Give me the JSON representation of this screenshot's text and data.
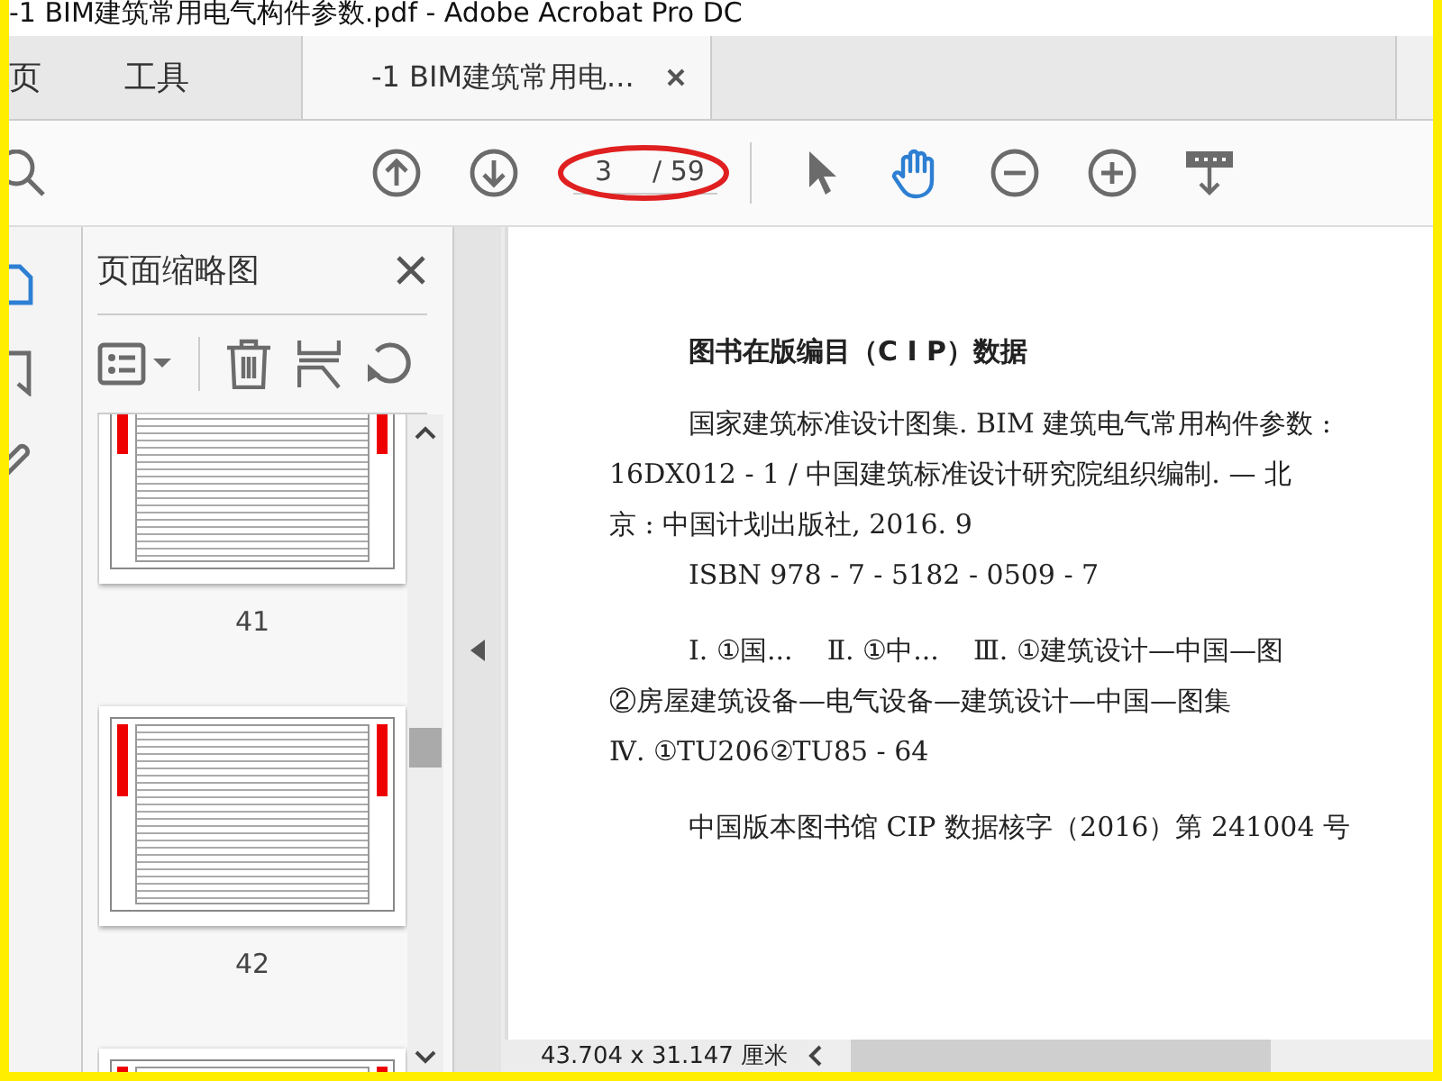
{
  "window": {
    "title": "-1 BIM建筑常用电气构件参数.pdf - Adobe Acrobat Pro DC"
  },
  "tabs": [
    {
      "label": "页",
      "selected": false,
      "closable": false
    },
    {
      "label": "工具",
      "selected": false,
      "closable": false
    },
    {
      "label": "-1 BIM建筑常用电...",
      "selected": true,
      "closable": true
    }
  ],
  "toolbar": {
    "page_number": "3",
    "page_total": "/ 59",
    "tools": [
      {
        "selected": false
      },
      {
        "selected": true
      },
      {
        "selected": false
      },
      {
        "selected": false
      },
      {
        "selected": false
      }
    ]
  },
  "nav_rail": [
    {
      "selected": true
    },
    {
      "selected": false
    },
    {
      "selected": false
    }
  ],
  "panel": {
    "title": "页面缩略图",
    "thumbnails": [
      {
        "label": "41"
      },
      {
        "label": "42"
      }
    ]
  },
  "document": {
    "heading": "图书在版编目（C I P）数据",
    "lines": [
      {
        "text": "国家建筑标准设计图集. BIM 建筑电气常用构件参数 :",
        "kind": "indented"
      },
      {
        "text": "16DX012 - 1 / 中国建筑标准设计研究院组织编制. — 北",
        "kind": "flush"
      },
      {
        "text": "京 : 中国计划出版社, 2016. 9",
        "kind": "flush"
      },
      {
        "text": "ISBN 978 - 7 - 5182 - 0509 - 7",
        "kind": "indented"
      },
      {
        "text": "Ⅰ. ①国...    Ⅱ. ①中...    Ⅲ. ①建筑设计—中国—图",
        "kind": "spaced"
      },
      {
        "text": "②房屋建筑设备—电气设备—建筑设计—中国—图集",
        "kind": "flush"
      },
      {
        "text": "Ⅳ. ①TU206②TU85 - 64",
        "kind": "flush"
      },
      {
        "text": "中国版本图书馆 CIP 数据核字（2016）第 241004 号",
        "kind": "spaced"
      }
    ]
  },
  "status_bar": {
    "page_size": "43.704 x 31.147 厘米"
  }
}
